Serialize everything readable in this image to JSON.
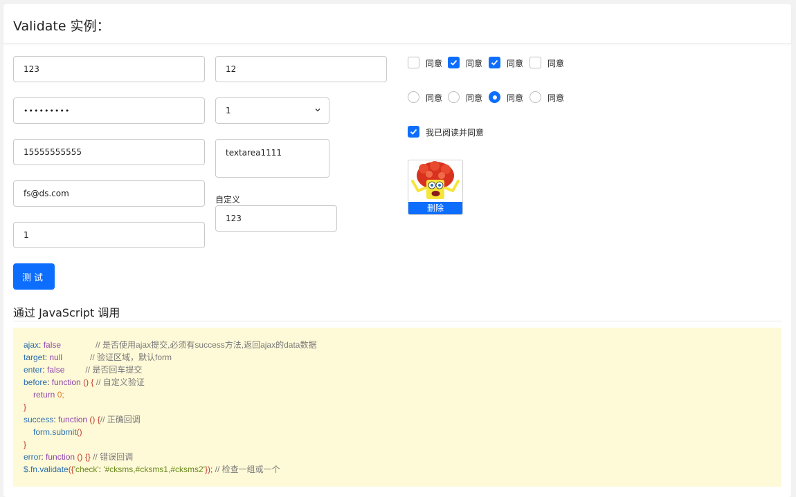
{
  "header": {
    "title": "Validate 实例："
  },
  "form": {
    "text_value": "123",
    "password_value": "•••••••••",
    "phone_value": "15555555555",
    "email_value": "fs@ds.com",
    "number_value": "1",
    "short_value": "12",
    "select_value": "1",
    "textarea_value": "textarea1111",
    "custom_label": "自定义",
    "custom_value": "123"
  },
  "checkboxes": [
    {
      "label": "同意",
      "checked": false
    },
    {
      "label": "同意",
      "checked": true
    },
    {
      "label": "同意",
      "checked": true
    },
    {
      "label": "同意",
      "checked": false
    }
  ],
  "radios": [
    {
      "label": "同意",
      "selected": false
    },
    {
      "label": "同意",
      "selected": false
    },
    {
      "label": "同意",
      "selected": true
    },
    {
      "label": "同意",
      "selected": false
    }
  ],
  "agree": {
    "label": "我已阅读并同意",
    "checked": true
  },
  "thumbnail": {
    "delete_label": "删除"
  },
  "submit_label": "测试",
  "section_title": "通过 JavaScript 调用",
  "code": {
    "l1": {
      "key": "ajax",
      "sep": ": ",
      "val": "false",
      "comment": "// 是否使用ajax提交,必须有success方法,返回ajax的data数据"
    },
    "l2": {
      "key": "target",
      "sep": ": ",
      "val": "null",
      "comment": "// 验证区域，默认form"
    },
    "l3": {
      "key": "enter",
      "sep": ": ",
      "val": "false",
      "comment": "// 是否回车提交"
    },
    "l4": {
      "key": "before",
      "sep": ": ",
      "val": "function",
      "paren": " ()",
      "brace": " {",
      "comment": " // 自定义验证"
    },
    "l5": {
      "kw": "return",
      "num": " 0",
      "end": ";"
    },
    "l6": {
      "brace": "}"
    },
    "l7": {
      "key": "success",
      "sep": ": ",
      "val": "function",
      "paren": " ()",
      "brace": " {",
      "comment": "// 正确回调"
    },
    "l8": {
      "call": "form.submit",
      "paren": "()"
    },
    "l9": {
      "brace": "}"
    },
    "l10": {
      "key": "error",
      "sep": ": ",
      "val": "function",
      "paren": " ()",
      "brace": " {}",
      "comment": " // 错误回调"
    },
    "l11": {
      "fn": "$.fn.validate",
      "open": "({",
      "str1": "'check'",
      "colon": ": ",
      "str2": "'#cksms,#cksms1,#cksms2'",
      "close": "});",
      "comment": " // 检查一组或一个"
    }
  },
  "colors": {
    "accent": "#0d6efd",
    "code_bg": "#fef9d7"
  }
}
